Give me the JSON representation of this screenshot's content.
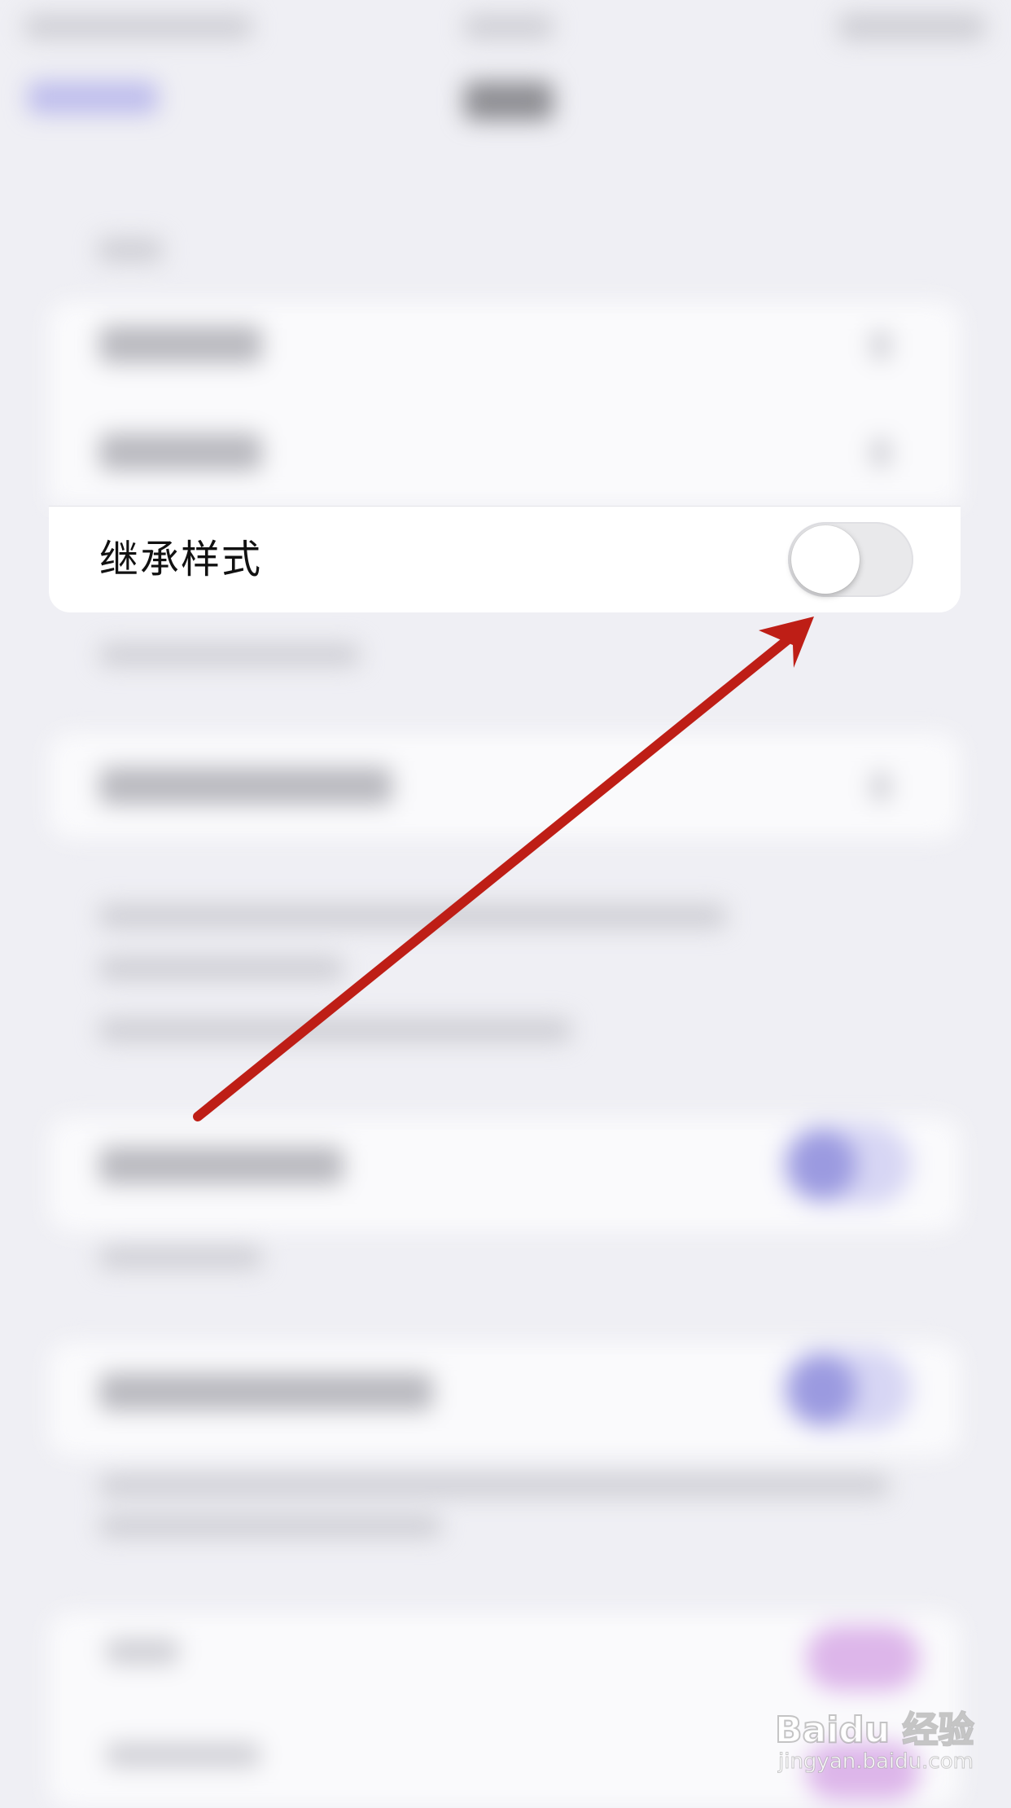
{
  "settings": {
    "inherit_style": {
      "label": "继承样式",
      "enabled": false
    }
  },
  "annotation": {
    "color": "#be1e16"
  },
  "watermark": {
    "logo_text": "Baidu 经验",
    "url": "jingyan.baidu.com"
  }
}
